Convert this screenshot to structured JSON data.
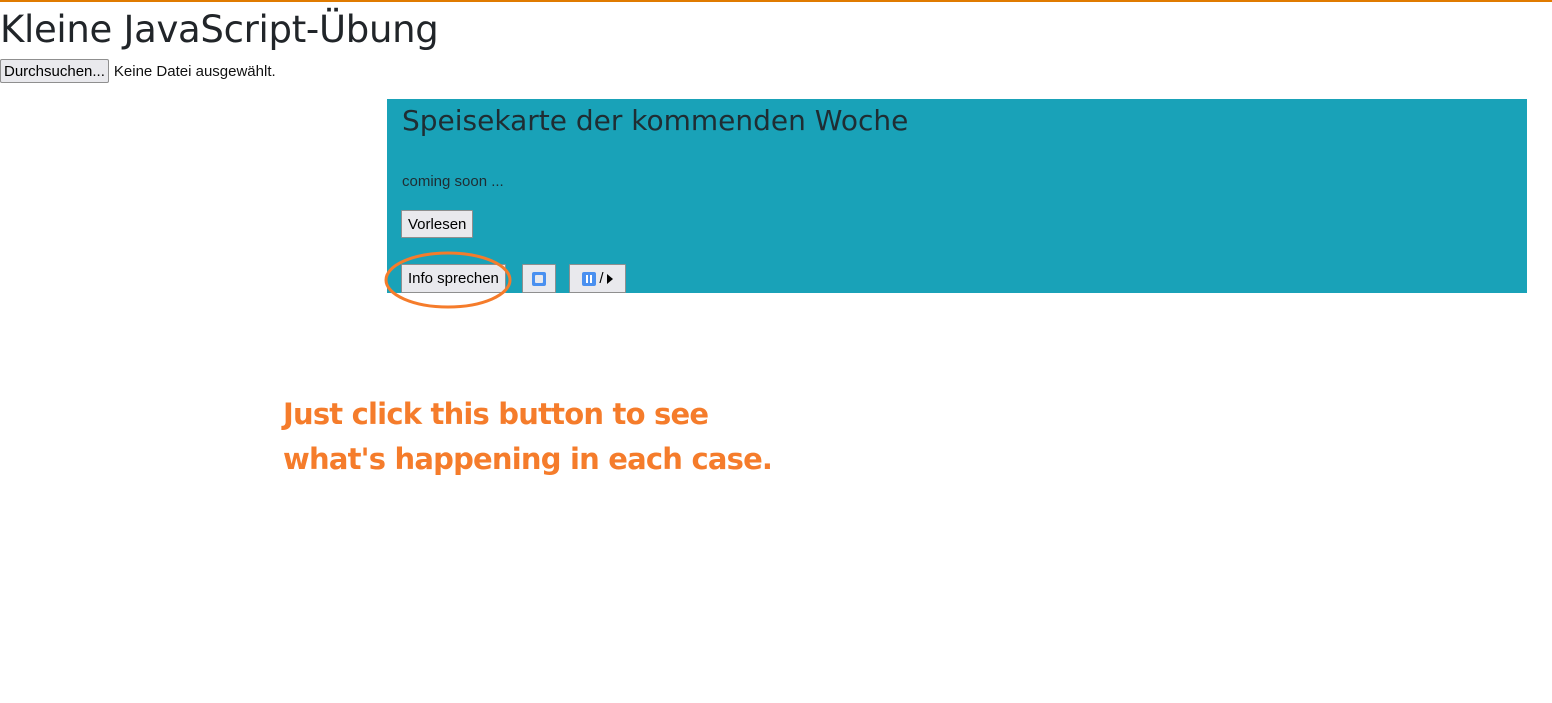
{
  "page": {
    "title": "Kleine JavaScript-Übung"
  },
  "file_input": {
    "button_label": "Durchsuchen...",
    "status": "Keine Datei ausgewählt."
  },
  "menu_panel": {
    "heading": "Speisekarte der kommenden Woche",
    "text": "coming soon ...",
    "read_button_label": "Vorlesen",
    "info_button_label": "Info sprechen",
    "stop_button_icon": "stop-icon",
    "pause_play_button": {
      "icons": [
        "pause-icon",
        "play-icon"
      ],
      "separator": "/"
    }
  },
  "annotation": {
    "line1": "Just click this button to see",
    "line2": "what's happening in each case."
  },
  "colors": {
    "top_border": "#e07b00",
    "panel_background": "#19a2b8",
    "annotation": "#f57c2b",
    "media_icon": "#4a90f0"
  }
}
